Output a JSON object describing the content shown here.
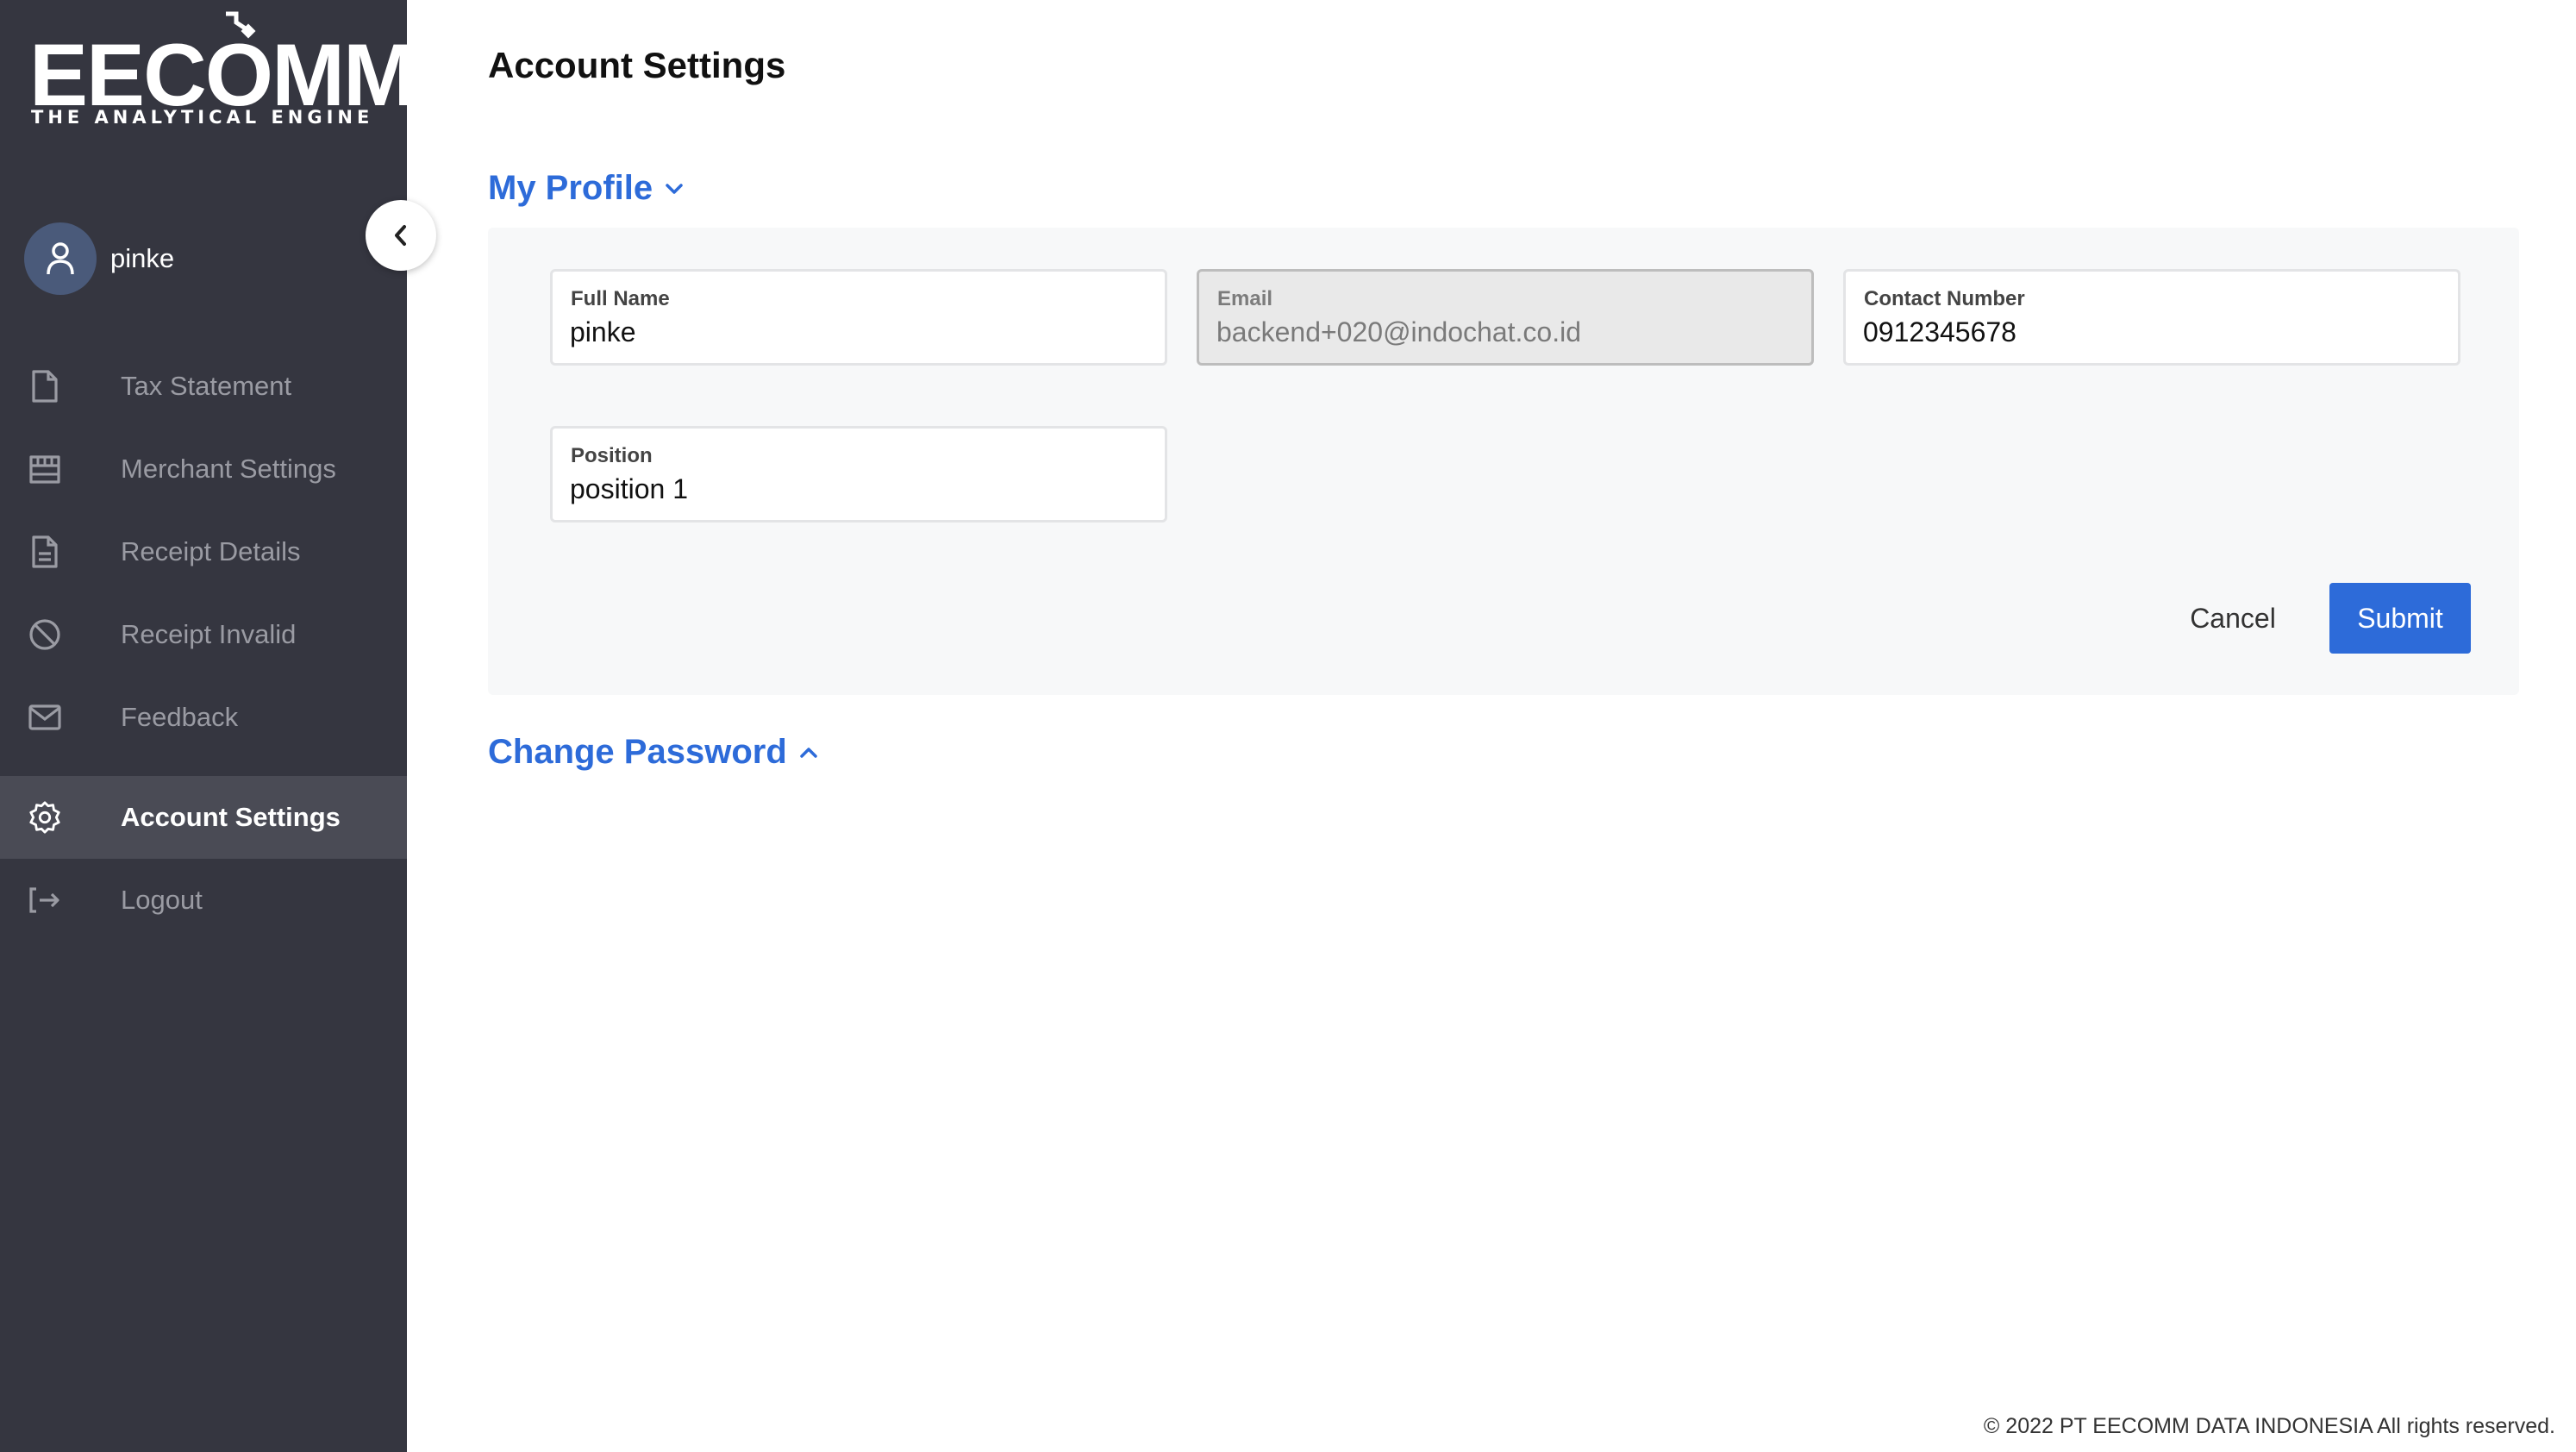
{
  "brand": {
    "logo_text": "EECOMM",
    "tagline": "THE ANALYTICAL ENGINE"
  },
  "user": {
    "name": "pinke",
    "avatar_icon": "user-icon"
  },
  "sidebar": {
    "collapse_icon": "chevron-left-icon",
    "items": [
      {
        "label": "Tax Statement",
        "icon": "file-icon",
        "active": false
      },
      {
        "label": "Merchant Settings",
        "icon": "store-icon",
        "active": false
      },
      {
        "label": "Receipt Details",
        "icon": "document-icon",
        "active": false
      },
      {
        "label": "Receipt Invalid",
        "icon": "ban-icon",
        "active": false
      },
      {
        "label": "Feedback",
        "icon": "mail-icon",
        "active": false
      },
      {
        "label": "Account Settings",
        "icon": "gear-icon",
        "active": true
      },
      {
        "label": "Logout",
        "icon": "logout-icon",
        "active": false
      }
    ]
  },
  "page": {
    "title": "Account Settings"
  },
  "profile": {
    "heading": "My Profile",
    "heading_icon": "chevron-down-icon",
    "fields": {
      "full_name": {
        "label": "Full Name",
        "value": "pinke"
      },
      "email": {
        "label": "Email",
        "value": "backend+020@indochat.co.id",
        "disabled": true
      },
      "contact": {
        "label": "Contact Number",
        "value": "0912345678"
      },
      "position": {
        "label": "Position",
        "value": "position 1"
      }
    },
    "cancel_label": "Cancel",
    "submit_label": "Submit"
  },
  "password": {
    "heading": "Change Password",
    "heading_icon": "chevron-up-icon"
  },
  "footer": {
    "text": "© 2022 PT EECOMM DATA INDONESIA All rights reserved."
  },
  "colors": {
    "sidebar_bg": "#353640",
    "accent": "#2d6bd9",
    "active_item_bg": "#4a4b55"
  }
}
